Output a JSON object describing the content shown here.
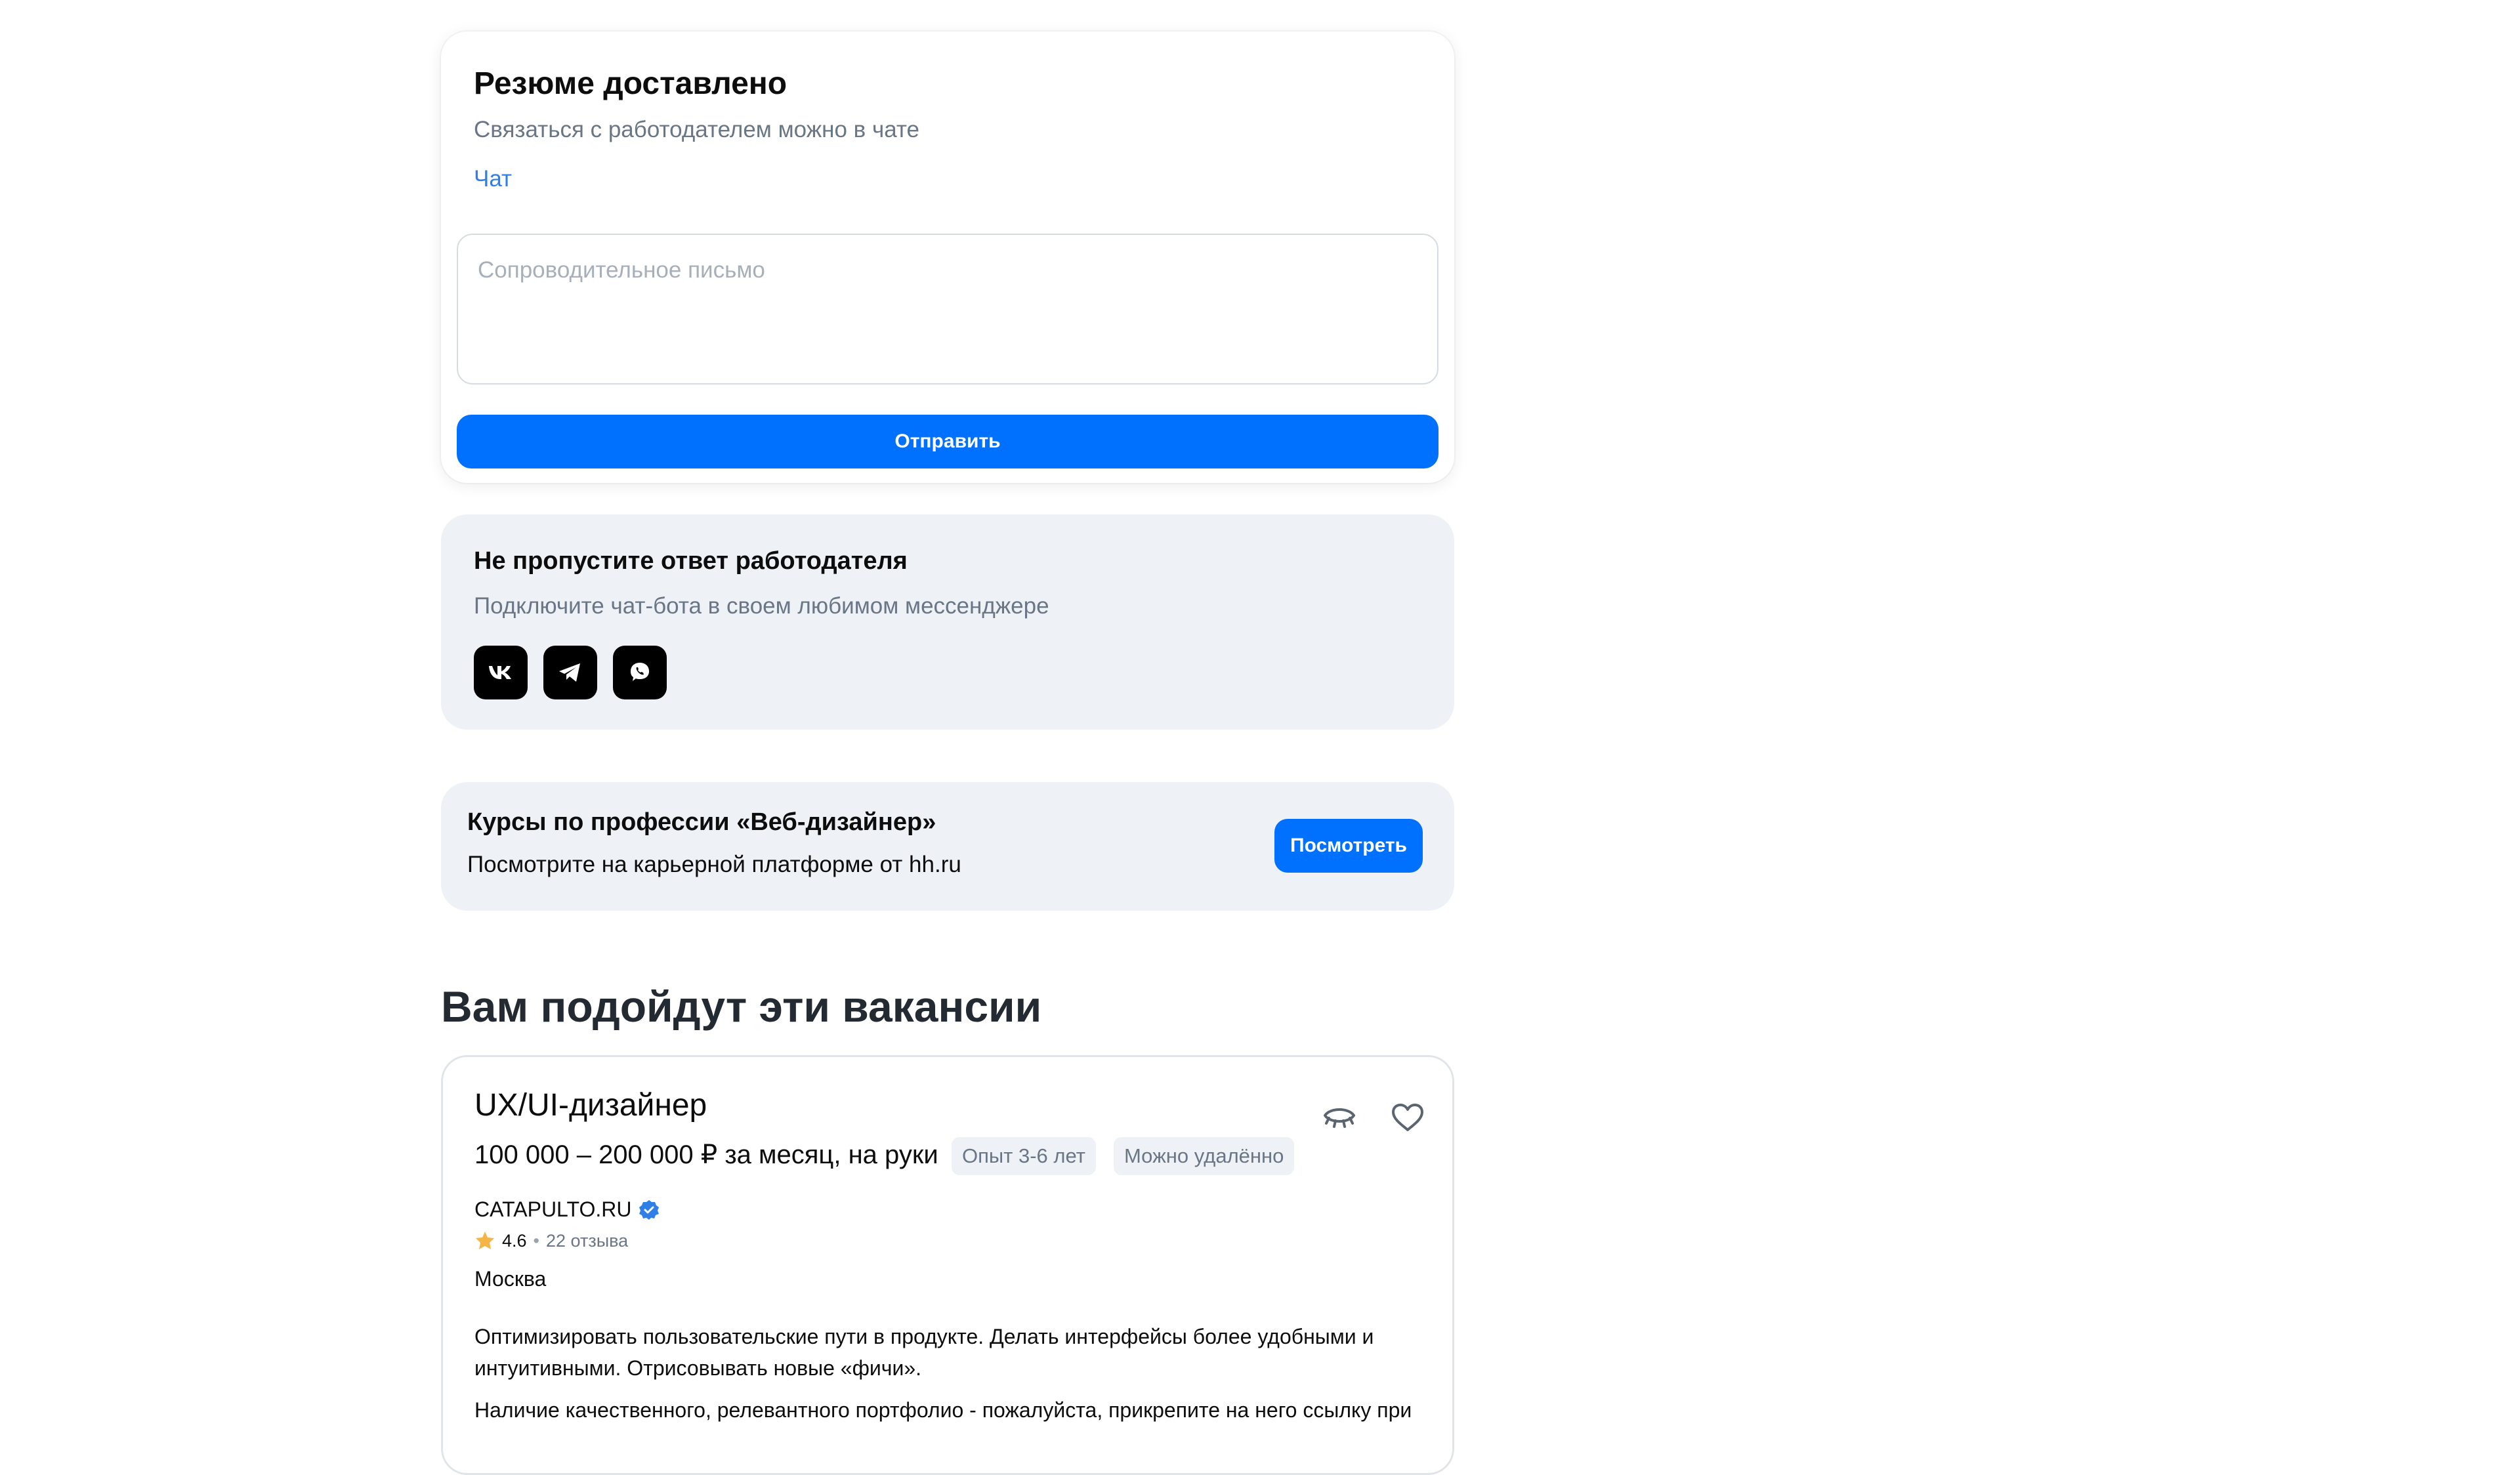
{
  "delivered_card": {
    "title": "Резюме доставлено",
    "subtitle": "Связаться с работодателем можно в чате",
    "chat_link": "Чат",
    "cover_letter_placeholder": "Сопроводительное письмо",
    "send_label": "Отправить"
  },
  "bot_card": {
    "title": "Не пропустите ответ работодателя",
    "subtitle": "Подключите чат-бота в своем любимом мессенджере",
    "messengers": [
      "vk-icon",
      "telegram-icon",
      "viber-icon"
    ]
  },
  "courses_card": {
    "title": "Курсы по профессии «Веб-дизайнер»",
    "subtitle": "Посмотрите на карьерной платформе от hh.ru",
    "button_label": "Посмотреть"
  },
  "recommendations": {
    "heading": "Вам подойдут эти вакансии",
    "vacancy": {
      "title": "UX/UI-дизайнер",
      "salary": "100 000 – 200 000 ₽ за месяц, на руки",
      "tags": [
        "Опыт 3-6 лет",
        "Можно удалённо"
      ],
      "company": "CATAPULTO.RU",
      "rating": "4.6",
      "separator": "•",
      "reviews": "22 отзыва",
      "city": "Москва",
      "description": "Оптимизировать пользовательские пути в продукте. Делать интерфейсы более удобными и интуитивными. Отрисовывать новые «фичи».",
      "requirements": "Наличие качественного, релевантного портфолио - пожалуйста, прикрепите на него ссылку при",
      "icons": [
        "hide-icon",
        "heart-icon"
      ]
    }
  },
  "colors": {
    "accent": "#0070ff",
    "link": "#2e7fe8",
    "card_bg": "#eef1f6",
    "muted_text": "#6a7685",
    "star": "#f5b546"
  }
}
